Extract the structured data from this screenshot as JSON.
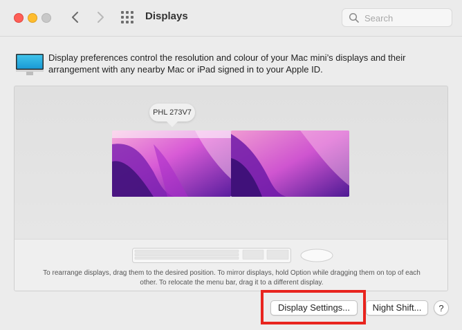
{
  "window": {
    "title": "Displays",
    "search": {
      "placeholder": "Search",
      "value": ""
    }
  },
  "icons": {
    "close": "close-dot",
    "minimize": "minimize-dot",
    "zoom": "zoom-dot",
    "back": "chevron-left-icon",
    "forward": "chevron-right-icon",
    "grid": "grid-icon",
    "search": "search-icon",
    "display": "display-icon",
    "keyboard": "keyboard-icon",
    "mouse": "mouse-icon"
  },
  "colors": {
    "close": "#fe5f57",
    "minimize": "#febc2e",
    "zoom": "#c8c8c8",
    "highlight": "#e8241e"
  },
  "info": {
    "text": "Display preferences control the resolution and colour of your Mac mini’s displays and their arrangement with any nearby Mac or iPad signed in to your Apple ID."
  },
  "arrangement": {
    "tooltip": "PHL 273V7",
    "hint": "To rearrange displays, drag them to the desired position. To mirror displays, hold Option while dragging them on top of each other. To relocate the menu bar, drag it to a different display."
  },
  "buttons": {
    "display_settings": "Display Settings...",
    "night_shift": "Night Shift...",
    "help": "?"
  }
}
